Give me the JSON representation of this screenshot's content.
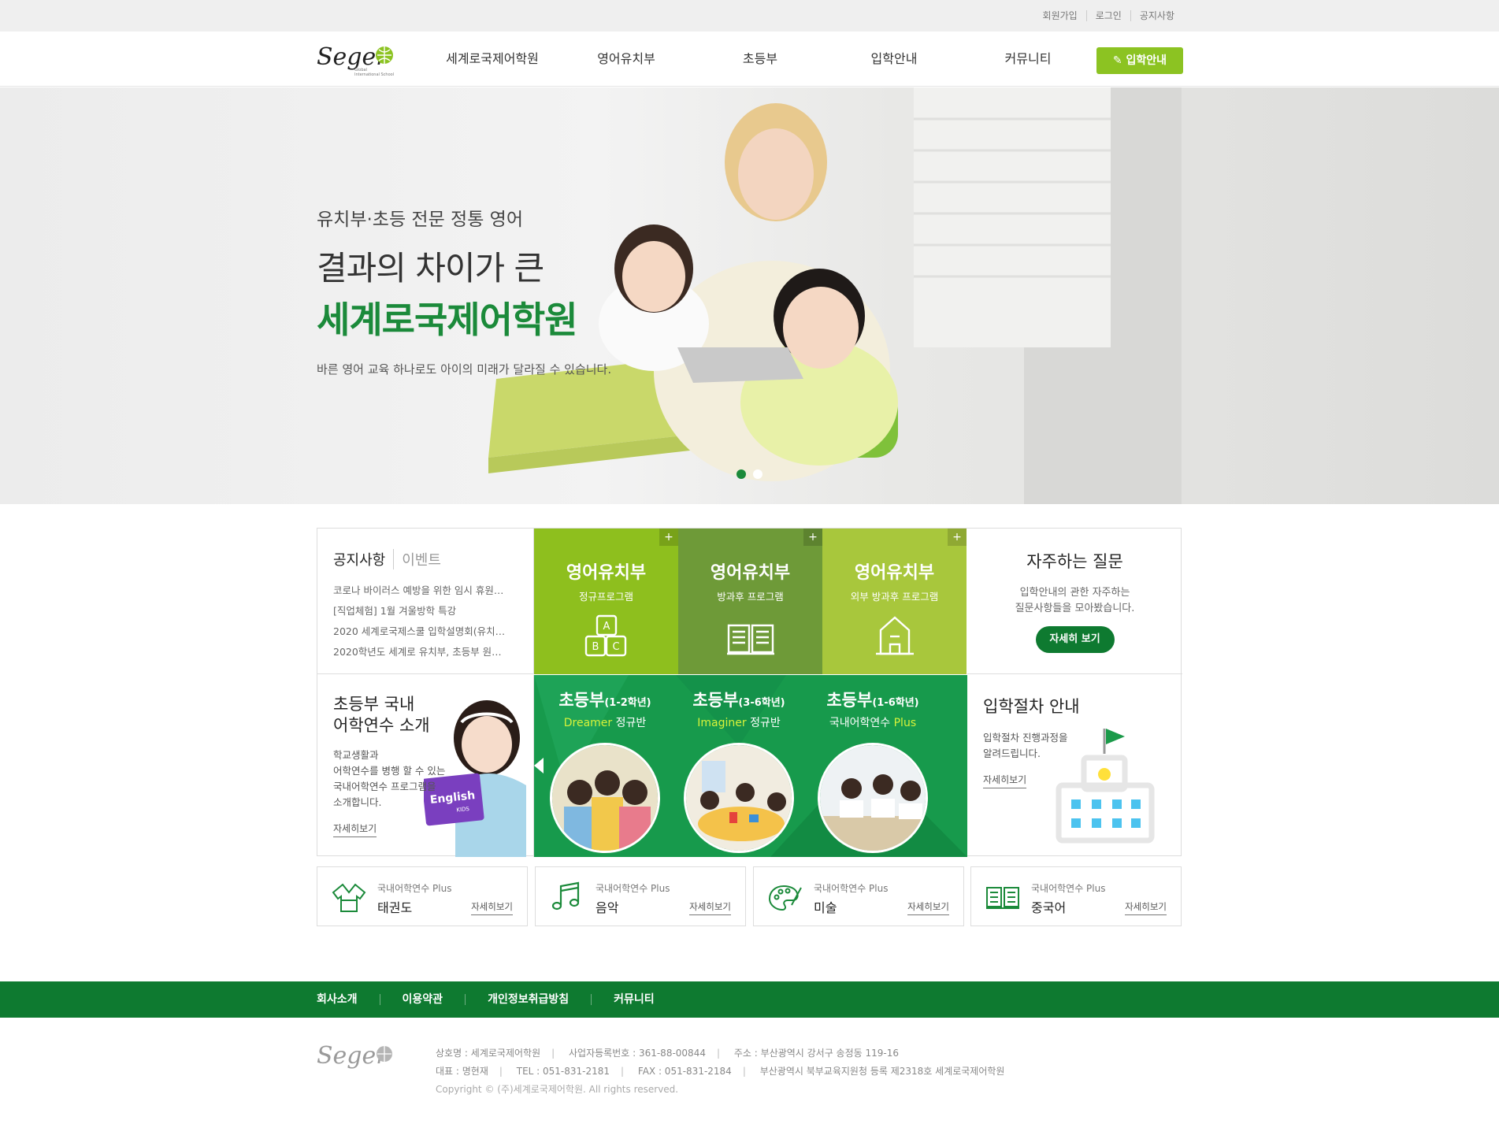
{
  "util": {
    "join": "회원가입",
    "login": "로그인",
    "notice": "공지사항"
  },
  "header": {
    "logo_alt": "Seger",
    "nav": [
      "세계로국제어학원",
      "영어유치부",
      "초등부",
      "입학안내",
      "커뮤니티"
    ],
    "cta": "입학안내"
  },
  "hero": {
    "line1": "유치부·초등 전문 정통 영어",
    "line2": "결과의 차이가 큰",
    "line3": "세계로국제어학원",
    "line4": "바른 영어 교육 하나로도 아이의 미래가 달라질 수 있습니다."
  },
  "notice": {
    "tab_on": "공지사항",
    "tab_off": "이벤트",
    "items": [
      "코로나 바이러스 예방을 위한 임시 휴원…",
      "[직업체험] 1월 겨울방학 특강",
      "2020 세계로국제스쿨 입학설명회(유치…",
      "2020학년도 세계로 유치부, 초등부 원…"
    ]
  },
  "programs": [
    {
      "title": "영어유치부",
      "sub": "정규프로그램",
      "color": "#8ebf1e"
    },
    {
      "title": "영어유치부",
      "sub": "방과후 프로그램",
      "color": "#6e9a38"
    },
    {
      "title": "영어유치부",
      "sub": "외부 방과후 프로그램",
      "color": "#a8c73c"
    }
  ],
  "faq": {
    "title": "자주하는 질문",
    "desc1": "입학안내의 관한 자주하는",
    "desc2": "질문사항들을 모아봤습니다.",
    "btn": "자세히 보기"
  },
  "elem": {
    "title1": "초등부 국내",
    "title2": "어학연수 소개",
    "desc": [
      "학교생활과",
      "어학연수를 병행 할 수 있는",
      "국내어학연수 프로그램을",
      "소개합니다."
    ],
    "more": "자세히보기"
  },
  "green": [
    {
      "h": "초등부",
      "hs": "(1-2학년)",
      "hl": "Dreamer",
      "s": " 정규반"
    },
    {
      "h": "초등부",
      "hs": "(3-6학년)",
      "hl": "Imaginer",
      "s": " 정규반"
    },
    {
      "h": "초등부",
      "hs": "(1-6학년)",
      "hl": "Plus",
      "s": "국내어학연수 "
    }
  ],
  "proc": {
    "title": "입학절차 안내",
    "desc1": "입학절차 진행과정을",
    "desc2": "알려드립니다.",
    "more": "자세히보기"
  },
  "plus": [
    {
      "small": "국내어학연수 Plus",
      "big": "태권도",
      "link": "자세히보기",
      "icon": "taekwondo-uniform-icon"
    },
    {
      "small": "국내어학연수 Plus",
      "big": "음악",
      "link": "자세히보기",
      "icon": "music-note-icon"
    },
    {
      "small": "국내어학연수 Plus",
      "big": "미술",
      "link": "자세히보기",
      "icon": "palette-icon"
    },
    {
      "small": "국내어학연수 Plus",
      "big": "중국어",
      "link": "자세히보기",
      "icon": "book-icon"
    }
  ],
  "footer": {
    "nav": [
      "회사소개",
      "이용약관",
      "개인정보취급방침",
      "커뮤니티"
    ],
    "row1": [
      "상호명 : 세계로국제어학원",
      "사업자등록번호 : 361-88-00844",
      "주소 : 부산광역시 강서구 송정동 119-16"
    ],
    "row2": [
      "대표 : 명현재",
      "TEL : 051-831-2181",
      "FAX : 051-831-2184",
      "부산광역시 북부교육지원청 등록 제2318호 세계로국제어학원"
    ],
    "copy": "Copyright © (주)세계로국제어학원. All rights reserved."
  },
  "colors": {
    "brand_green": "#0e7a30",
    "accent_lime": "#8cc322",
    "headline_green": "#1b8a3a"
  }
}
